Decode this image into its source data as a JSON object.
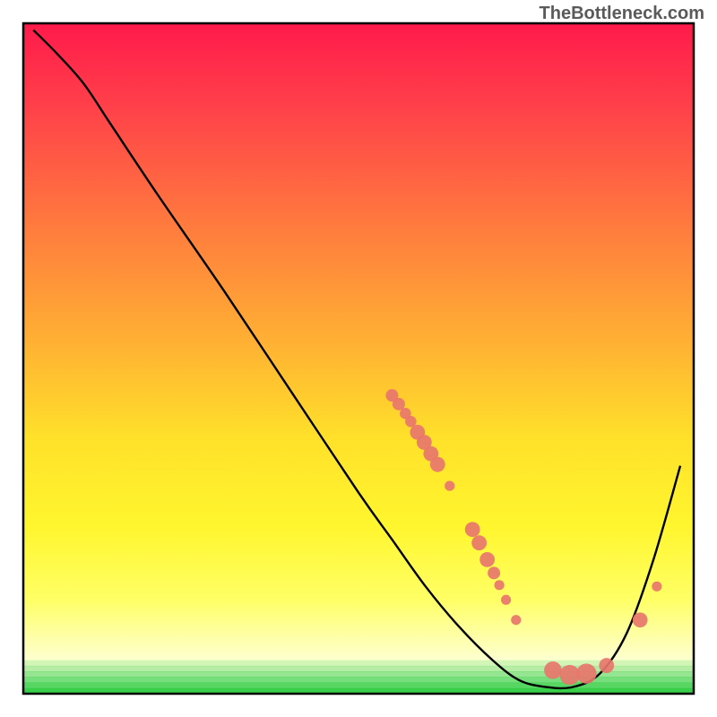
{
  "watermark": "TheBottleneck.com",
  "chart_data": {
    "type": "line",
    "title": "",
    "xlabel": "",
    "ylabel": "",
    "xlim": [
      0,
      100
    ],
    "ylim": [
      0,
      100
    ],
    "grid": false,
    "curve_note": "Bottleneck performance curve. No numeric axis labels visible; x and y scales are implicit (0-100).",
    "curve": [
      {
        "x": 1.5,
        "y": 99.0
      },
      {
        "x": 5.0,
        "y": 95.5
      },
      {
        "x": 9.0,
        "y": 91.0
      },
      {
        "x": 13.0,
        "y": 85.0
      },
      {
        "x": 20.0,
        "y": 74.5
      },
      {
        "x": 30.0,
        "y": 60.0
      },
      {
        "x": 40.0,
        "y": 45.0
      },
      {
        "x": 50.0,
        "y": 30.0
      },
      {
        "x": 55.0,
        "y": 23.0
      },
      {
        "x": 60.0,
        "y": 16.0
      },
      {
        "x": 65.0,
        "y": 10.0
      },
      {
        "x": 70.0,
        "y": 5.0
      },
      {
        "x": 74.0,
        "y": 2.0
      },
      {
        "x": 78.0,
        "y": 1.0
      },
      {
        "x": 82.0,
        "y": 1.0
      },
      {
        "x": 86.0,
        "y": 3.0
      },
      {
        "x": 90.0,
        "y": 9.0
      },
      {
        "x": 94.0,
        "y": 20.0
      },
      {
        "x": 98.0,
        "y": 34.0
      }
    ],
    "markers": [
      {
        "x": 55.0,
        "y": 44.5,
        "r": 1.0
      },
      {
        "x": 56.0,
        "y": 43.2,
        "r": 1.0
      },
      {
        "x": 57.0,
        "y": 41.8,
        "r": 0.9
      },
      {
        "x": 57.8,
        "y": 40.6,
        "r": 0.9
      },
      {
        "x": 58.8,
        "y": 39.0,
        "r": 1.2
      },
      {
        "x": 59.8,
        "y": 37.5,
        "r": 1.2
      },
      {
        "x": 60.8,
        "y": 35.8,
        "r": 1.2
      },
      {
        "x": 61.8,
        "y": 34.2,
        "r": 1.2
      },
      {
        "x": 63.6,
        "y": 31.0,
        "r": 0.8
      },
      {
        "x": 67.0,
        "y": 24.5,
        "r": 1.2
      },
      {
        "x": 68.0,
        "y": 22.5,
        "r": 1.2
      },
      {
        "x": 69.2,
        "y": 20.0,
        "r": 1.2
      },
      {
        "x": 70.2,
        "y": 18.0,
        "r": 1.0
      },
      {
        "x": 71.0,
        "y": 16.2,
        "r": 0.8
      },
      {
        "x": 72.0,
        "y": 14.0,
        "r": 0.8
      },
      {
        "x": 73.5,
        "y": 11.0,
        "r": 0.8
      },
      {
        "x": 79.0,
        "y": 3.5,
        "r": 1.4
      },
      {
        "x": 81.5,
        "y": 2.8,
        "r": 1.6
      },
      {
        "x": 84.0,
        "y": 3.0,
        "r": 1.6
      },
      {
        "x": 87.0,
        "y": 4.2,
        "r": 1.2
      },
      {
        "x": 92.0,
        "y": 11.0,
        "r": 1.2
      },
      {
        "x": 94.5,
        "y": 16.0,
        "r": 0.8
      }
    ],
    "green_band": {
      "y_low": 0,
      "y_high": 5.0
    },
    "colors": {
      "curve": "#000000",
      "marker": "#e8766d",
      "green": "#2ecc40"
    }
  }
}
